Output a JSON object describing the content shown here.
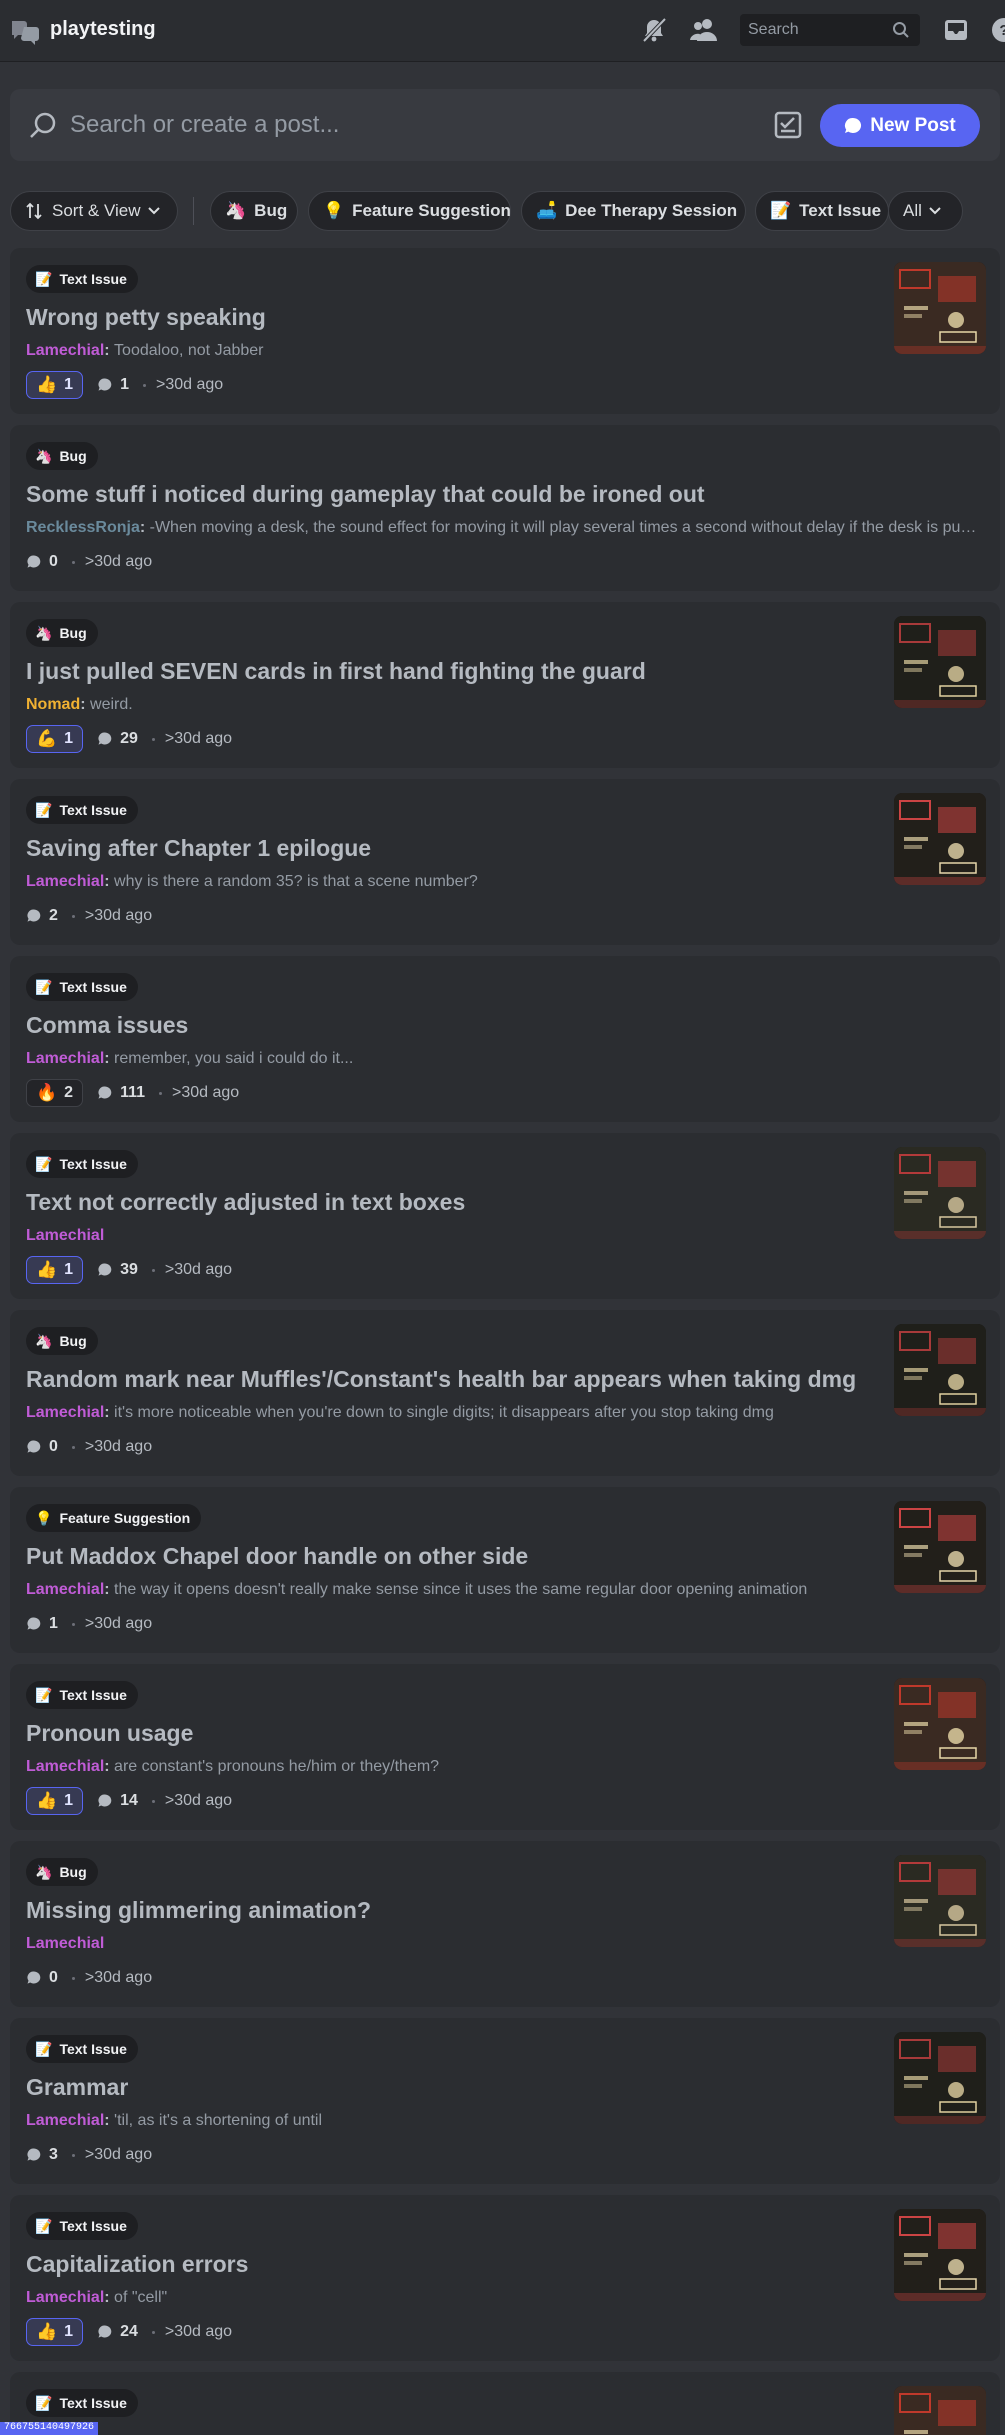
{
  "topbar": {
    "channel_name": "playtesting",
    "search_placeholder": "Search",
    "icons": [
      "forum-channel-icon",
      "notifications-muted-icon",
      "member-list-icon",
      "search-icon",
      "inbox-icon",
      "help-icon"
    ]
  },
  "search_bar": {
    "placeholder": "Search or create a post...",
    "new_post_label": "New Post"
  },
  "filters": {
    "sort_label": "Sort & View",
    "tags": [
      {
        "emoji": "🦄",
        "label": "Bug"
      },
      {
        "emoji": "💡",
        "label": "Feature Suggestion"
      },
      {
        "emoji": "🛋️",
        "label": "Dee Therapy Session"
      },
      {
        "emoji": "📝",
        "label": "Text Issue"
      }
    ],
    "all_label": "All"
  },
  "posts": [
    {
      "tag": "Text Issue",
      "tag_emoji": "📝",
      "title": "Wrong petty speaking",
      "author": "Lamechial",
      "author_color": "#c05cd6",
      "preview": "Toodaloo, not Jabber",
      "reaction_emoji": "👍",
      "reaction_count": "1",
      "replies": "1",
      "age": ">30d ago",
      "has_thumb": true
    },
    {
      "tag": "Bug",
      "tag_emoji": "🦄",
      "title": "Some stuff i noticed during gameplay that could be ironed out",
      "author": "RecklessRonja",
      "author_color": "#6a8a9c",
      "preview": "-When moving a desk, the sound effect for moving it will play several times a second without delay if the desk is pushed again",
      "reaction_emoji": "",
      "reaction_count": "",
      "replies": "0",
      "age": ">30d ago",
      "has_thumb": false
    },
    {
      "tag": "Bug",
      "tag_emoji": "🦄",
      "title": "I just pulled SEVEN cards in first hand fighting the guard",
      "author": "Nomad",
      "author_color": "#f0b132",
      "preview": "weird.",
      "reaction_emoji": "💪",
      "reaction_count": "1",
      "replies": "29",
      "age": ">30d ago",
      "has_thumb": true
    },
    {
      "tag": "Text Issue",
      "tag_emoji": "📝",
      "title": "Saving after Chapter 1 epilogue",
      "author": "Lamechial",
      "author_color": "#c05cd6",
      "preview": "why is there a random 35? is that a scene number?",
      "reaction_emoji": "",
      "reaction_count": "",
      "replies": "2",
      "age": ">30d ago",
      "has_thumb": true
    },
    {
      "tag": "Text Issue",
      "tag_emoji": "📝",
      "title": "Comma issues",
      "author": "Lamechial",
      "author_color": "#c05cd6",
      "preview": "remember, you said i could do it...",
      "reaction_emoji": "🔥",
      "reaction_count": "2",
      "replies": "111",
      "age": ">30d ago",
      "has_thumb": false
    },
    {
      "tag": "Text Issue",
      "tag_emoji": "📝",
      "title": "Text not correctly adjusted in text boxes",
      "author": "Lamechial",
      "author_color": "#c05cd6",
      "preview": "",
      "reaction_emoji": "👍",
      "reaction_count": "1",
      "replies": "39",
      "age": ">30d ago",
      "has_thumb": true
    },
    {
      "tag": "Bug",
      "tag_emoji": "🦄",
      "title": "Random mark near Muffles'/Constant's health bar appears when taking dmg",
      "author": "Lamechial",
      "author_color": "#c05cd6",
      "preview": "it's more noticeable when you're down to single digits; it disappears after you stop taking dmg",
      "reaction_emoji": "",
      "reaction_count": "",
      "replies": "0",
      "age": ">30d ago",
      "has_thumb": true
    },
    {
      "tag": "Feature Suggestion",
      "tag_emoji": "💡",
      "title": "Put Maddox Chapel door handle on other side",
      "author": "Lamechial",
      "author_color": "#c05cd6",
      "preview": "the way it opens doesn't really make sense since it uses the same regular door opening animation",
      "reaction_emoji": "",
      "reaction_count": "",
      "replies": "1",
      "age": ">30d ago",
      "has_thumb": true
    },
    {
      "tag": "Text Issue",
      "tag_emoji": "📝",
      "title": "Pronoun usage",
      "author": "Lamechial",
      "author_color": "#c05cd6",
      "preview": "are constant's pronouns he/him or they/them?",
      "reaction_emoji": "👍",
      "reaction_count": "1",
      "replies": "14",
      "age": ">30d ago",
      "has_thumb": true
    },
    {
      "tag": "Bug",
      "tag_emoji": "🦄",
      "title": "Missing glimmering animation?",
      "author": "Lamechial",
      "author_color": "#c05cd6",
      "preview": "",
      "reaction_emoji": "",
      "reaction_count": "",
      "replies": "0",
      "age": ">30d ago",
      "has_thumb": true
    },
    {
      "tag": "Text Issue",
      "tag_emoji": "📝",
      "title": "Grammar",
      "author": "Lamechial",
      "author_color": "#c05cd6",
      "preview": "'til, as it's a shortening of until",
      "reaction_emoji": "",
      "reaction_count": "",
      "replies": "3",
      "age": ">30d ago",
      "has_thumb": true
    },
    {
      "tag": "Text Issue",
      "tag_emoji": "📝",
      "title": "Capitalization errors",
      "author": "Lamechial",
      "author_color": "#c05cd6",
      "preview": "of \"cell\"",
      "reaction_emoji": "👍",
      "reaction_count": "1",
      "replies": "24",
      "age": ">30d ago",
      "has_thumb": true
    },
    {
      "tag": "Text Issue",
      "tag_emoji": "📝",
      "title": "",
      "author": "",
      "author_color": "#c05cd6",
      "preview": "",
      "reaction_emoji": "",
      "reaction_count": "",
      "replies": "",
      "age": "",
      "has_thumb": true
    }
  ],
  "status_link": "766755140497926"
}
